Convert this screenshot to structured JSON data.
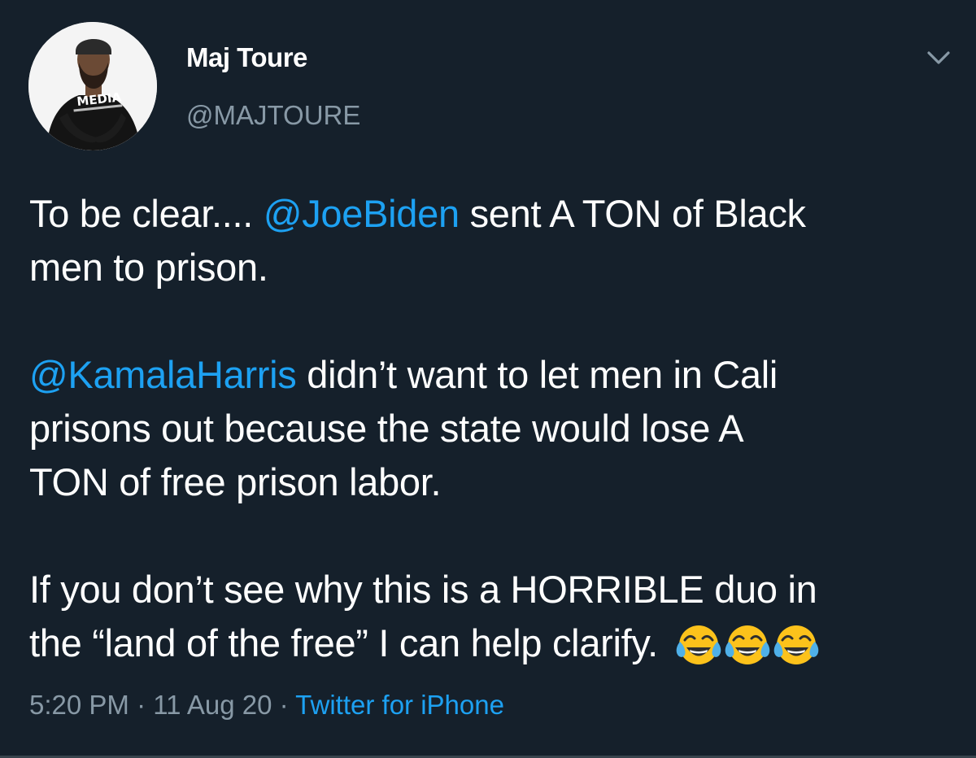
{
  "colors": {
    "background": "#15202b",
    "text_primary": "#ffffff",
    "text_secondary": "#8899a6",
    "accent_link": "#1da1f2"
  },
  "author": {
    "display_name": "Maj Toure",
    "handle": "@MAJTOURE",
    "avatar_shirt_text": "MEDIA"
  },
  "tweet": {
    "lines": [
      {
        "text": "To be clear.... ",
        "mention": "@JoeBiden",
        "after": " sent A TON of Black"
      },
      {
        "text": "men to prison."
      },
      {
        "text": ""
      },
      {
        "mention": "@KamalaHarris",
        "after": " didn’t want to let men in Cali"
      },
      {
        "text": "prisons out because the state would lose A"
      },
      {
        "text": "TON of free prison labor."
      },
      {
        "text": ""
      },
      {
        "text": "If you don’t see why this is a HORRIBLE duo in"
      },
      {
        "text": "the “land of the free” I can help clarify. "
      }
    ],
    "emoji": [
      "face-with-tears-of-joy",
      "face-with-tears-of-joy",
      "face-with-tears-of-joy"
    ]
  },
  "meta": {
    "time": "5:20 PM",
    "sep1": " · ",
    "date": "11 Aug 20",
    "sep2": " · ",
    "source": "Twitter for iPhone"
  },
  "icons": {
    "menu": "chevron-down-icon"
  }
}
